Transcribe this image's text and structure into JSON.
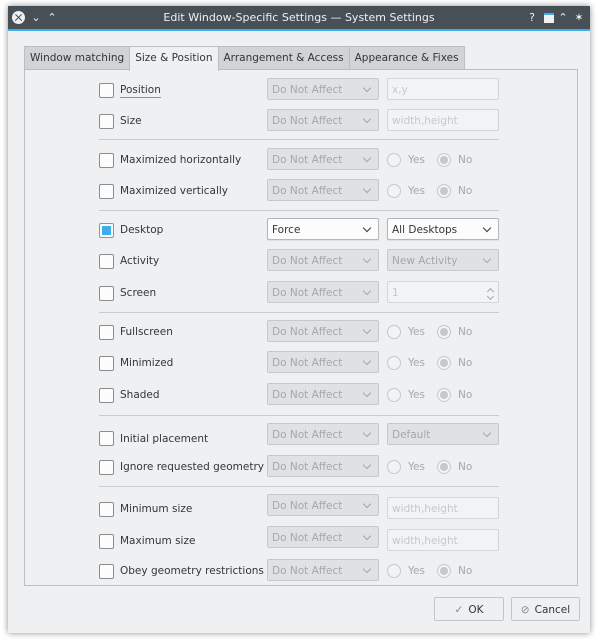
{
  "window": {
    "title": "Edit Window-Specific Settings — System Settings",
    "titlebar_buttons": {
      "help": "?",
      "keep_above": "⌃",
      "pin": "✶"
    }
  },
  "tabs": [
    {
      "label": "Window matching",
      "active": false
    },
    {
      "label": "Size & Position",
      "active": true
    },
    {
      "label": "Arrangement & Access",
      "active": false
    },
    {
      "label": "Appearance & Fixes",
      "active": false
    }
  ],
  "rows": [
    {
      "label": "Position",
      "checked": false,
      "policy": "Do Not Affect",
      "placeholder": "x,y"
    },
    {
      "label": "Size",
      "checked": false,
      "policy": "Do Not Affect",
      "placeholder": "width,height"
    },
    {
      "label": "Maximized horizontally",
      "checked": false,
      "policy": "Do Not Affect",
      "yes": "Yes",
      "no": "No",
      "value": "No"
    },
    {
      "label": "Maximized vertically",
      "checked": false,
      "policy": "Do Not Affect",
      "yes": "Yes",
      "no": "No",
      "value": "No"
    },
    {
      "label": "Desktop",
      "checked": true,
      "policy": "Force",
      "option": "All Desktops"
    },
    {
      "label": "Activity",
      "checked": false,
      "policy": "Do Not Affect",
      "option": "New Activity"
    },
    {
      "label": "Screen",
      "checked": false,
      "policy": "Do Not Affect",
      "spin_value": "1"
    },
    {
      "label": "Fullscreen",
      "checked": false,
      "policy": "Do Not Affect",
      "yes": "Yes",
      "no": "No",
      "value": "No"
    },
    {
      "label": "Minimized",
      "checked": false,
      "policy": "Do Not Affect",
      "yes": "Yes",
      "no": "No",
      "value": "No"
    },
    {
      "label": "Shaded",
      "checked": false,
      "policy": "Do Not Affect",
      "yes": "Yes",
      "no": "No",
      "value": "No"
    },
    {
      "label": "Initial placement",
      "checked": false,
      "policy": "Do Not Affect",
      "option": "Default"
    },
    {
      "label": "Ignore requested geometry",
      "checked": false,
      "policy": "Do Not Affect",
      "yes": "Yes",
      "no": "No",
      "value": "No"
    },
    {
      "label": "Minimum size",
      "checked": false,
      "policy": "Do Not Affect",
      "placeholder": "width,height"
    },
    {
      "label": "Maximum size",
      "checked": false,
      "policy": "Do Not Affect",
      "placeholder": "width,height"
    },
    {
      "label": "Obey geometry restrictions",
      "checked": false,
      "policy": "Do Not Affect",
      "yes": "Yes",
      "no": "No",
      "value": "No"
    }
  ],
  "buttons": {
    "ok": "OK",
    "cancel": "Cancel"
  },
  "colors": {
    "accent": "#3daee9",
    "titlebar": "#475057",
    "window_bg": "#eff0f1"
  }
}
